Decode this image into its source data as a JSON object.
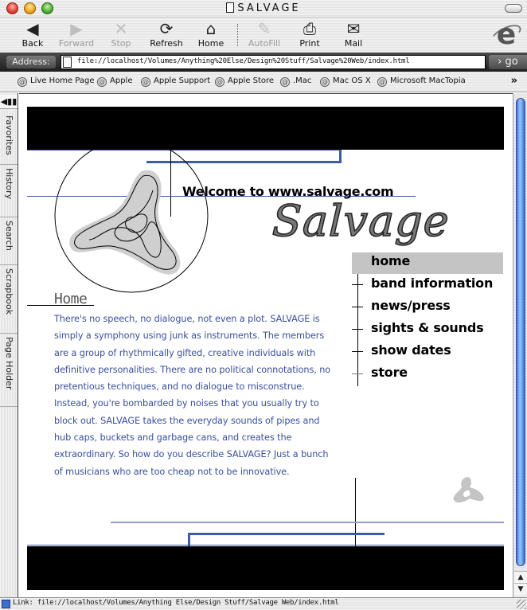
{
  "window": {
    "title": "SALVAGE"
  },
  "toolbar": {
    "buttons": [
      {
        "label": "Back",
        "icon": "back-arrow-icon",
        "glyph": "◀",
        "enabled": true
      },
      {
        "label": "Forward",
        "icon": "forward-arrow-icon",
        "glyph": "▶",
        "enabled": false
      },
      {
        "label": "Stop",
        "icon": "stop-x-icon",
        "glyph": "✕",
        "enabled": false
      },
      {
        "label": "Refresh",
        "icon": "refresh-icon",
        "glyph": "⟳",
        "enabled": true
      },
      {
        "label": "Home",
        "icon": "home-icon",
        "glyph": "⌂",
        "enabled": true
      },
      {
        "label": "AutoFill",
        "icon": "autofill-icon",
        "glyph": "✎",
        "enabled": false
      },
      {
        "label": "Print",
        "icon": "printer-icon",
        "glyph": "⎙",
        "enabled": true
      },
      {
        "label": "Mail",
        "icon": "mail-icon",
        "glyph": "✉",
        "enabled": true
      }
    ],
    "brand_glyph": "e"
  },
  "address": {
    "label": "Address:",
    "value": "file://localhost/Volumes/Anything%20Else/Design%20Stuff/Salvage%20Web/index.html",
    "go_label": "› go"
  },
  "favorites": {
    "items": [
      {
        "label": "Live Home Page"
      },
      {
        "label": "Apple"
      },
      {
        "label": "Apple Support"
      },
      {
        "label": "Apple Store"
      },
      {
        "label": ".Mac"
      },
      {
        "label": "Mac OS X"
      },
      {
        "label": "Microsoft MacTopia"
      }
    ],
    "more_glyph": "»",
    "at_glyph": "@"
  },
  "sidetabs": {
    "toggle_glyph": "◀▮▮",
    "items": [
      {
        "label": "Favorites"
      },
      {
        "label": "History"
      },
      {
        "label": "Search"
      },
      {
        "label": "Scrapbook"
      },
      {
        "label": "Page Holder"
      }
    ]
  },
  "page": {
    "welcome": "Welcome to www.salvage.com",
    "logo_text": "Salvage",
    "nav": [
      {
        "label": "home",
        "active": true
      },
      {
        "label": "band information",
        "active": false
      },
      {
        "label": "news/press",
        "active": false
      },
      {
        "label": "sights & sounds",
        "active": false
      },
      {
        "label": "show dates",
        "active": false
      },
      {
        "label": "store",
        "active": false
      }
    ],
    "heading": "Home",
    "body": "There's no speech, no dialogue, not even a plot.  SALVAGE is simply a symphony using junk as instruments.  The members are a group of rhythmically gifted, creative individuals with definitive personalities.  There are no political connotations, no pretentious techniques, and no dialogue to misconstrue. Instead, you're bombarded by noises that you usually try to block out.  SALVAGE takes the everyday sounds of pipes and hub caps, buckets and garbage cans, and creates the extraordinary.  So how do you describe SALVAGE?  Just a bunch of musicians who are too cheap not to be innovative.",
    "colors": {
      "body_text": "#3a4f9e",
      "accent_line": "#3b5ba5",
      "light_line": "#8f9cc8",
      "nav_active_bg": "#c4c4c4"
    }
  },
  "scrollbar": {
    "up_glyph": "▲",
    "down_glyph": "▼"
  },
  "status": {
    "text": "Link: file://localhost/Volumes/Anything Else/Design Stuff/Salvage Web/index.html"
  }
}
